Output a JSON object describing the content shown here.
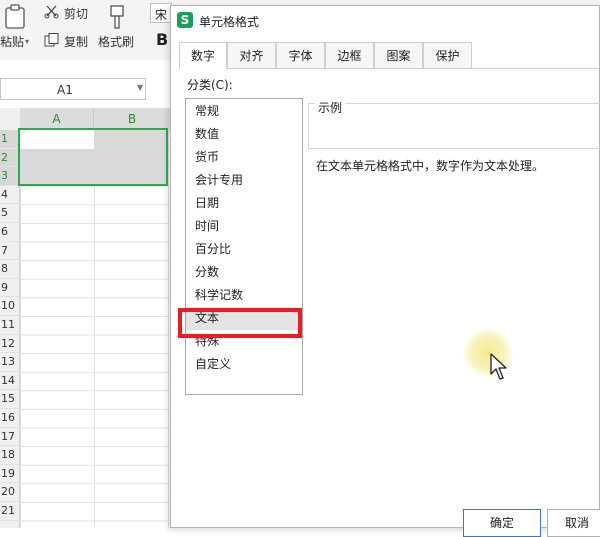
{
  "ribbon": {
    "paste_label": "粘贴",
    "cut_label": "剪切",
    "copy_label": "复制",
    "format_painter_label": "格式刷",
    "font_name_partial": "宋",
    "bold_label": "B"
  },
  "namebox": {
    "value": "A1"
  },
  "sheet": {
    "columns": [
      "A",
      "B"
    ],
    "rows": [
      "1",
      "2",
      "3",
      "4",
      "5",
      "6",
      "7",
      "8",
      "9",
      "10",
      "11",
      "12",
      "13",
      "14",
      "15",
      "16",
      "17",
      "18",
      "19",
      "20",
      "21"
    ],
    "selected_rows": [
      "1",
      "2",
      "3"
    ]
  },
  "dialog": {
    "title": "单元格格式",
    "tabs": [
      "数字",
      "对齐",
      "字体",
      "边框",
      "图案",
      "保护"
    ],
    "active_tab": "数字",
    "category_label": "分类(C):",
    "categories": [
      "常规",
      "数值",
      "货币",
      "会计专用",
      "日期",
      "时间",
      "百分比",
      "分数",
      "科学记数",
      "文本",
      "特殊",
      "自定义"
    ],
    "selected_category": "文本",
    "sample_label": "示例",
    "description": "在文本单元格格式中，数字作为文本处理。",
    "ok_label": "确定",
    "cancel_label": "取消"
  },
  "colors": {
    "selection_green": "#2fa84f",
    "highlight_red": "#ea1c24",
    "app_logo_green": "#1aa25b"
  },
  "icons": [
    "paste-icon",
    "cut-icon",
    "copy-icon",
    "format-painter-icon",
    "app-logo-icon",
    "mouse-cursor-icon"
  ]
}
